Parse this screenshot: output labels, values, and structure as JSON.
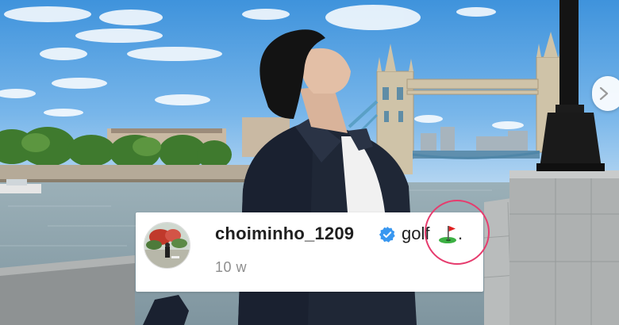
{
  "post": {
    "username": "choiminho_1209",
    "caption": "golf",
    "caption_emoji": "flag-in-hole-icon",
    "caption_end": ".",
    "time_ago": "10 w",
    "verified": true
  },
  "colors": {
    "sky": "#4f9fe0",
    "river": "#8aa2ae",
    "jacket": "#1d2533",
    "verified_badge": "#3897f0",
    "highlight_circle": "#e63c6e",
    "flag": "#e02020",
    "green": "#3cb043"
  },
  "icons": [
    "next-arrow-icon",
    "verified-badge-icon",
    "flag-in-hole-icon"
  ]
}
